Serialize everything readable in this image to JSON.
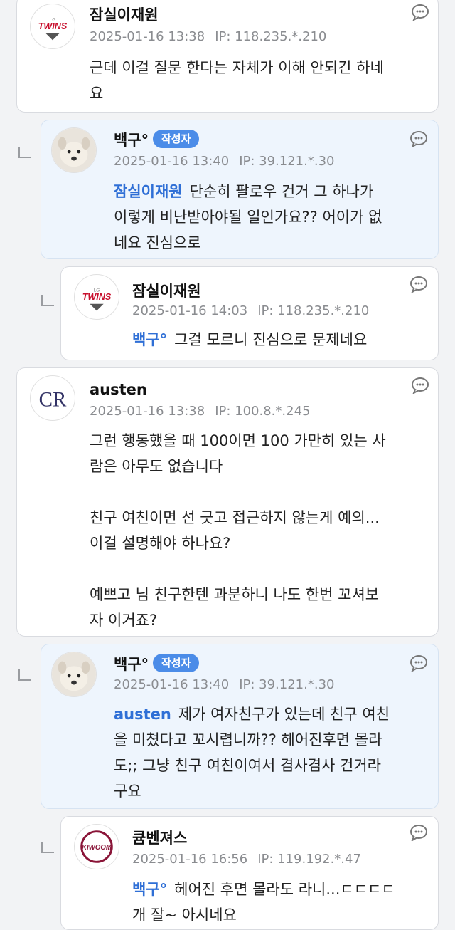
{
  "comments": [
    {
      "author": "잠실이재원",
      "date": "2025-01-16 13:38",
      "ip": "IP: 118.235.*.210",
      "body": "근데 이걸 질문 한다는 자체가 이해 안되긴 하네\n요",
      "avatar": "twins-logo",
      "avatar_text": "TWINS",
      "avatar_small": "LG"
    },
    {
      "author": "백구°",
      "badge": "작성자",
      "date": "2025-01-16 13:40",
      "ip": "IP: 39.121.*.30",
      "mention": "잠실이재원",
      "body": "단순히 팔로우 건거 그 하나가\n이렇게 비난받아야될 일인가요?? 어이가 없\n네요 진심으로",
      "avatar": "dog-photo"
    },
    {
      "author": "잠실이재원",
      "date": "2025-01-16 14:03",
      "ip": "IP: 118.235.*.210",
      "mention": "백구°",
      "body": "그걸 모르니 진심으로 문제네요",
      "avatar": "twins-logo",
      "avatar_text": "TWINS",
      "avatar_small": "LG"
    },
    {
      "author": "austen",
      "date": "2025-01-16 13:38",
      "ip": "IP: 100.8.*.245",
      "body": "그런 행동했을 때 100이면 100 가만히 있는 사\n람은 아무도 없습니다\n\n친구 여친이면 선 긋고 접근하지 않는게 예의...\n이걸 설명해야 하나요?\n\n예쁘고 님 친구한텐 과분하니 나도 한번 꼬셔보\n자 이거죠?",
      "avatar": "rockies-logo",
      "avatar_text": "CR"
    },
    {
      "author": "백구°",
      "badge": "작성자",
      "date": "2025-01-16 13:40",
      "ip": "IP: 39.121.*.30",
      "mention": "austen",
      "body": "제가 여자친구가 있는데 친구 여친\n을 미쳤다고 꼬시렵니까?? 헤어진후면 몰라\n도;; 그냥 친구 여친이여서 겸사겸사 건거라\n구요",
      "avatar": "dog-photo"
    },
    {
      "author": "큠벤져스",
      "date": "2025-01-16 16:56",
      "ip": "IP: 119.192.*.47",
      "mention": "백구°",
      "body": "헤어진 후면 몰라도 라니...ㄷㄷㄷㄷ\n개 잘~ 아시네요",
      "avatar": "kiwoom-logo",
      "avatar_text": "KIWOOM"
    }
  ]
}
